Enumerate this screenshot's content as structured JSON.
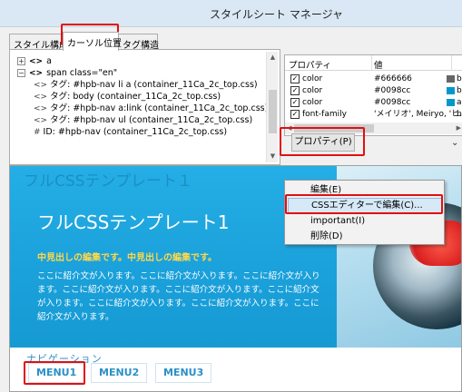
{
  "window": {
    "title": "スタイルシート マネージャ"
  },
  "tabs": [
    {
      "label": "スタイル構成",
      "active": false
    },
    {
      "label": "カーソル位置",
      "active": true
    },
    {
      "label": "タグ構造",
      "active": false
    }
  ],
  "tree": [
    {
      "expander": "+",
      "tag": "<>",
      "text": "a"
    },
    {
      "expander": "−",
      "tag": "<>",
      "text": "span class=\"en\""
    },
    {
      "icon": "<>",
      "text": "タグ: #hpb-nav li a (container_11Ca_2c_top.css)"
    },
    {
      "icon": "<>",
      "text": "タグ: body (container_11Ca_2c_top.css)"
    },
    {
      "icon": "<>",
      "text": "タグ: #hpb-nav a:link (container_11Ca_2c_top.css)"
    },
    {
      "icon": "<>",
      "text": "タグ: #hpb-nav ul (container_11Ca_2c_top.css)"
    },
    {
      "icon": "#",
      "text": "ID: #hpb-nav (container_11Ca_2c_top.css)"
    }
  ],
  "properties": {
    "headers": {
      "property": "プロパティ",
      "value": "値"
    },
    "rows": [
      {
        "checked": true,
        "name": "color",
        "value": "#666666",
        "swatch": "#666666",
        "tail": "b"
      },
      {
        "checked": true,
        "name": "color",
        "value": "#0098cc",
        "swatch": "#0098cc",
        "tail": "b"
      },
      {
        "checked": true,
        "name": "color",
        "value": "#0098cc",
        "swatch": "#0098cc",
        "tail": "a"
      },
      {
        "checked": true,
        "name": "font-family",
        "value": "'メイリオ', Meiryo, 'ヒ...",
        "swatch": "",
        "tail": "b"
      }
    ]
  },
  "property_button": "プロパティ(P)",
  "context_menu": {
    "items": [
      {
        "label": "編集(E)",
        "highlighted": false
      },
      {
        "label": "CSSエディターで編集(C)...",
        "highlighted": true
      },
      {
        "label": "important(I)",
        "highlighted": false
      },
      {
        "label": "削除(D)",
        "highlighted": false
      }
    ]
  },
  "preview": {
    "small_heading": "フルCSSテンプレート１",
    "big_heading": "フルCSSテンプレート1",
    "subheading": "中見出しの編集です。中見出しの編集です。",
    "paragraph": "ここに紹介文が入ります。ここに紹介文が入ります。ここに紹介文が入ります。ここに紹介文が入ります。ここに紹介文が入ります。ここに紹介文が入ります。ここに紹介文が入ります。ここに紹介文が入ります。ここに紹介文が入ります。",
    "nav_label": "ナビゲーション",
    "menus": [
      "MENU1",
      "MENU2",
      "MENU3"
    ]
  },
  "colors": {
    "accent": "#1aa0da",
    "highlight_border": "#e01010",
    "menu_text": "#2b90c8",
    "subheading": "#ffd84a"
  }
}
